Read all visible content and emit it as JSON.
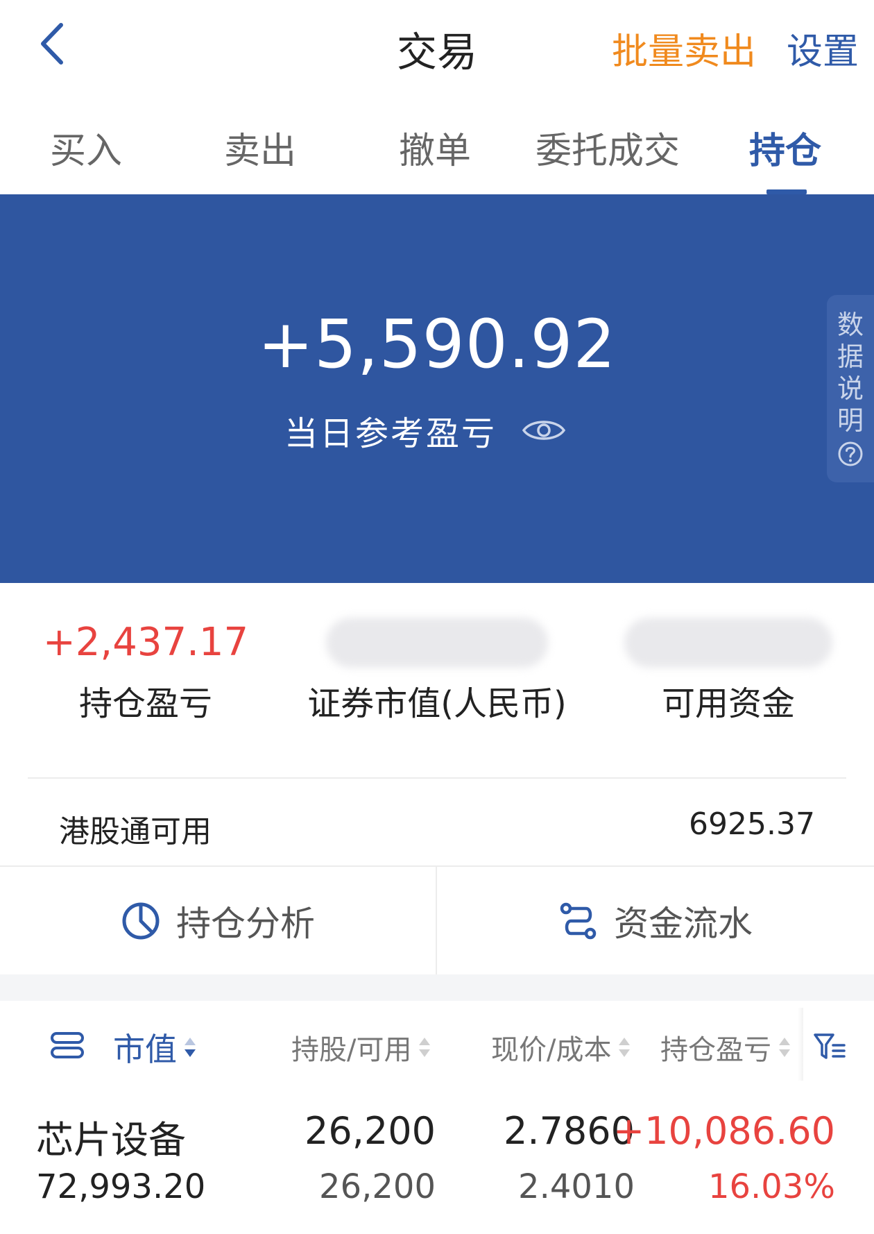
{
  "header": {
    "title": "交易",
    "batch_sell": "批量卖出",
    "settings": "设置"
  },
  "tabs": [
    {
      "label": "买入"
    },
    {
      "label": "卖出"
    },
    {
      "label": "撤单"
    },
    {
      "label": "委托成交"
    },
    {
      "label": "持仓",
      "active": true
    }
  ],
  "hero": {
    "daily_pnl": "+5,590.92",
    "daily_pnl_label": "当日参考盈亏",
    "data_note": "数据说明",
    "background": "#2f56a0"
  },
  "summary": {
    "position_pnl_value": "+2,437.17",
    "position_pnl_label": "持仓盈亏",
    "market_value_label": "证券市值(人民币)",
    "available_funds_label": "可用资金"
  },
  "hk_connect": {
    "label": "港股通可用",
    "value": "6925.37"
  },
  "actions": {
    "position_analysis": "持仓分析",
    "fund_flow": "资金流水"
  },
  "table": {
    "columns": {
      "market_value": "市值",
      "holding": "持股/可用",
      "price": "现价/成本",
      "pnl": "持仓盈亏"
    },
    "rows": [
      {
        "name": "芯片设备",
        "market_value": "72,993.20",
        "holding": "26,200",
        "available": "26,200",
        "price": "2.7860",
        "cost": "2.4010",
        "pnl": "+10,086.60",
        "pnl_pct": "16.03%"
      }
    ]
  },
  "colors": {
    "accent": "#2f5aa8",
    "batch_sell": "#f08a1e",
    "gain": "#e8433f"
  }
}
